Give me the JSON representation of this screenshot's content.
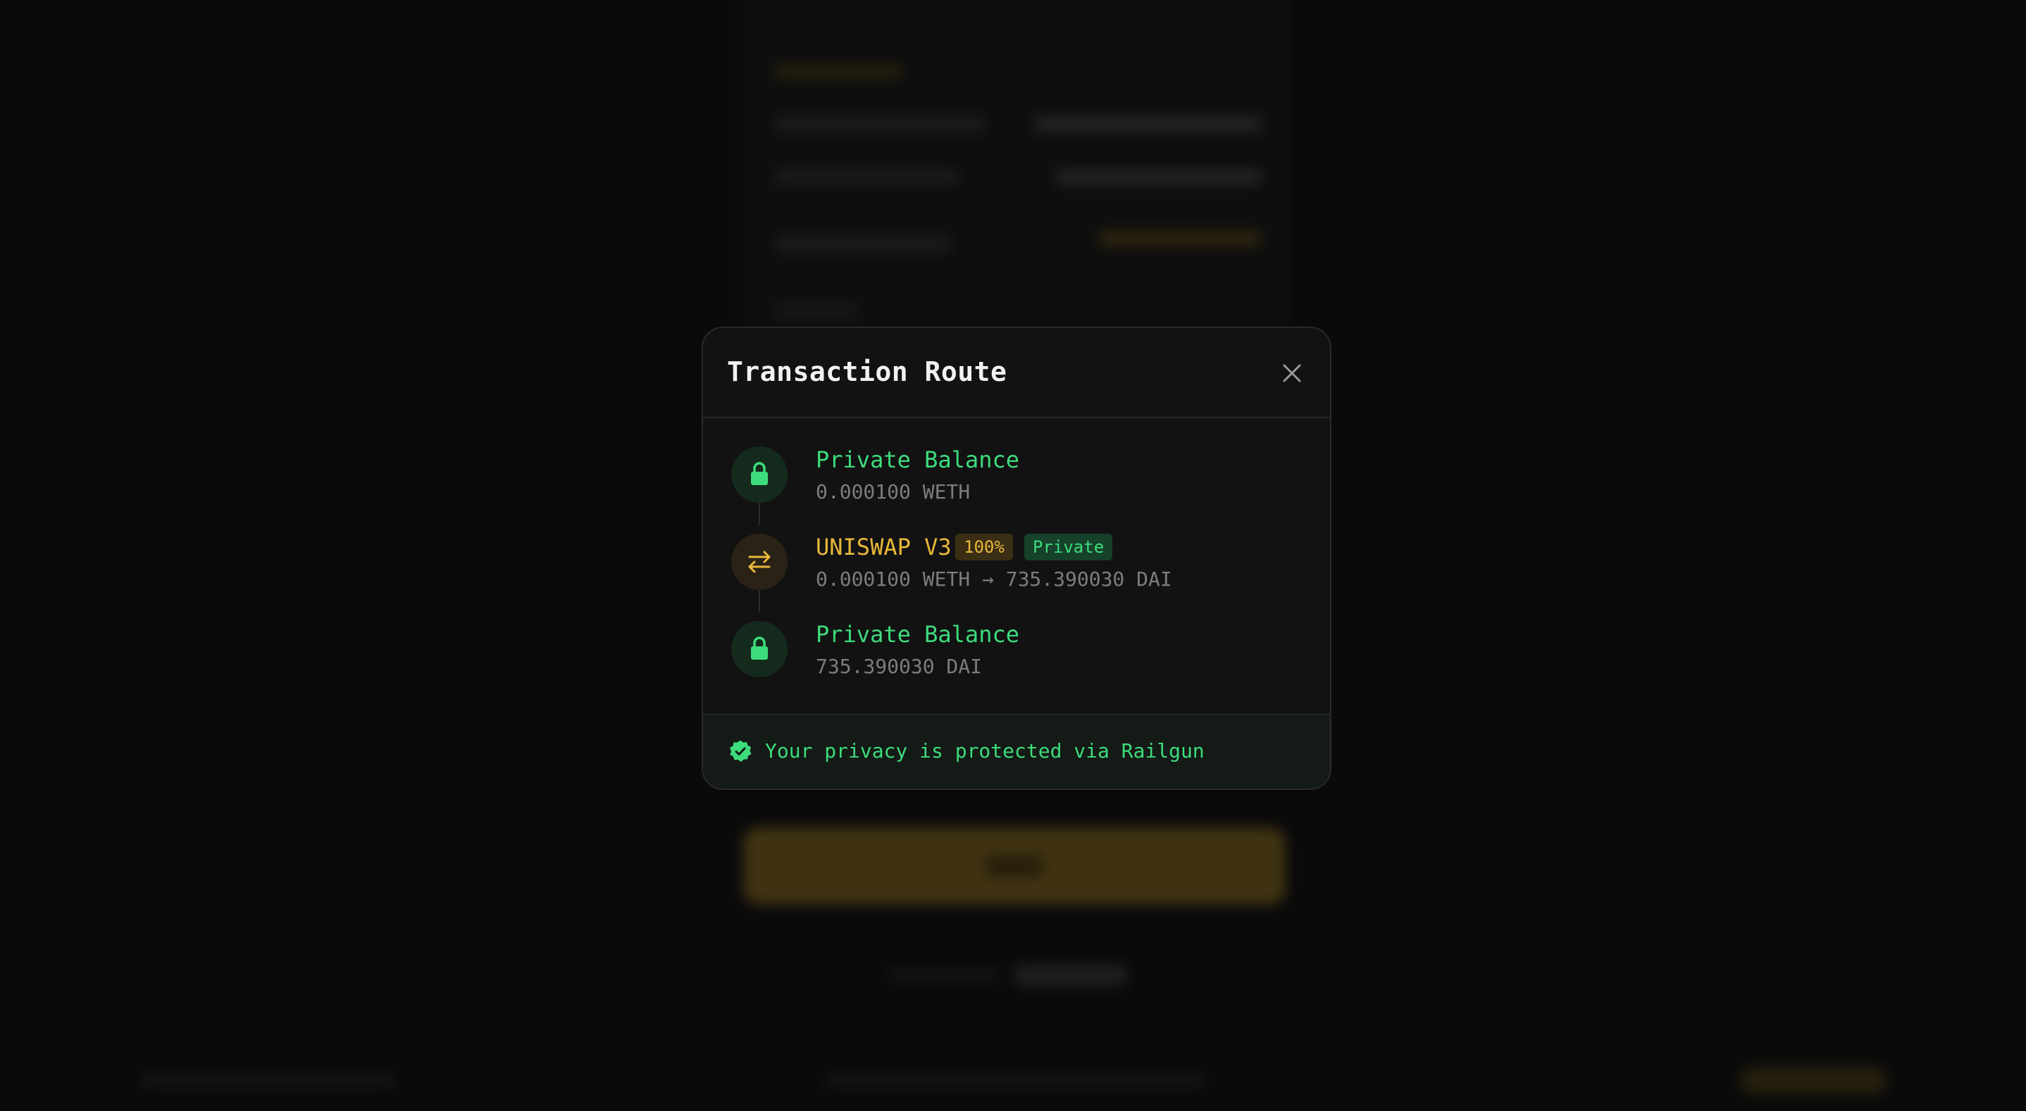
{
  "modal": {
    "title": "Transaction Route",
    "close_icon": "close-icon"
  },
  "route": {
    "steps": [
      {
        "icon": "lock-icon",
        "title": "Private Balance",
        "subtitle": "0.000100 WETH"
      },
      {
        "icon": "swap-arrows-icon",
        "title": "UNISWAP V3",
        "percent_badge": "100%",
        "privacy_badge": "Private",
        "subtitle": "0.000100 WETH → 735.390030 DAI"
      },
      {
        "icon": "lock-icon",
        "title": "Private Balance",
        "subtitle": "735.390030 DAI"
      }
    ]
  },
  "footer": {
    "icon": "verified-check-icon",
    "text": "Your privacy is protected via Railgun"
  },
  "colors": {
    "accent_green": "#3ddc7c",
    "accent_gold": "#e8b83a",
    "background": "#0a0a0a",
    "modal_surface": "#121212"
  }
}
